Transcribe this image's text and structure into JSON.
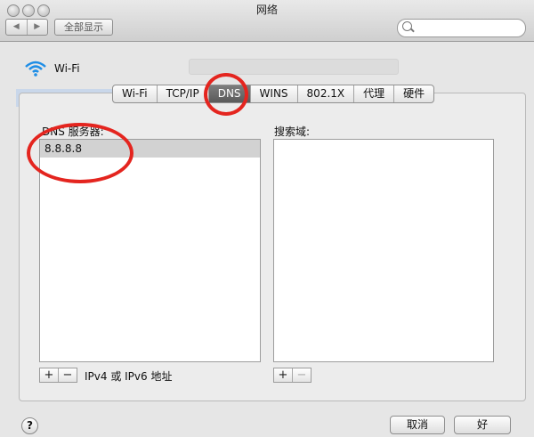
{
  "window": {
    "title": "网络"
  },
  "toolbar": {
    "back_icon": "◀",
    "forward_icon": "▶",
    "show_all_label": "全部显示",
    "search_placeholder": ""
  },
  "network": {
    "service_name": "Wi-Fi"
  },
  "tabs": [
    {
      "label": "Wi-Fi",
      "active": false
    },
    {
      "label": "TCP/IP",
      "active": false
    },
    {
      "label": "DNS",
      "active": true
    },
    {
      "label": "WINS",
      "active": false
    },
    {
      "label": "802.1X",
      "active": false
    },
    {
      "label": "代理",
      "active": false
    },
    {
      "label": "硬件",
      "active": false
    }
  ],
  "dns": {
    "label": "DNS 服务器:",
    "servers": [
      "8.8.8.8"
    ],
    "add_label": "+",
    "remove_label": "−",
    "hint": "IPv4 或 IPv6 地址"
  },
  "search_domains": {
    "label": "搜索域:",
    "domains": [],
    "add_label": "+",
    "remove_label": "−"
  },
  "footer": {
    "help_label": "?",
    "cancel_label": "取消",
    "ok_label": "好"
  },
  "annotation_color": "#e4251f"
}
